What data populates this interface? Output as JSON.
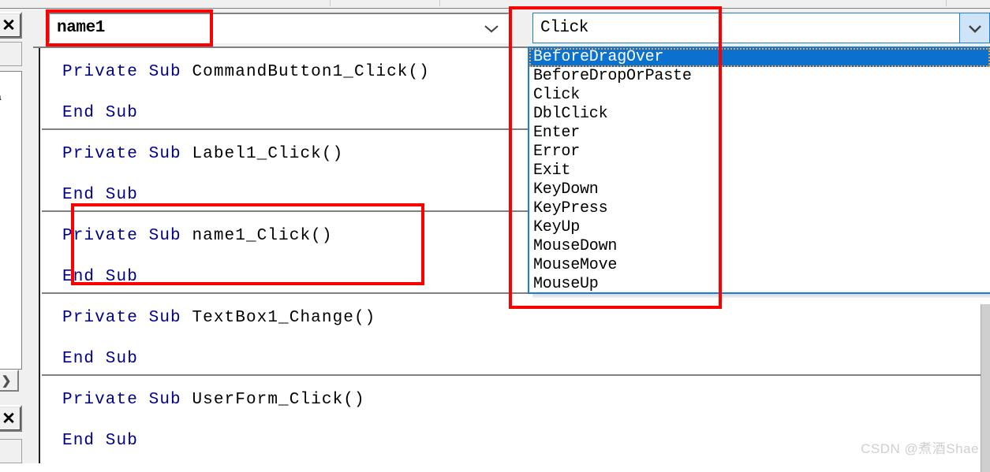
{
  "app": {
    "name": "VBA Editor Code Window",
    "watermark": "CSDN @煮酒Shae"
  },
  "toolbar": {
    "strip_label": ""
  },
  "left_panel": {
    "close_button_top_label": "✕",
    "blank_button_label": "",
    "scroll_right_arrow_label": "❯",
    "close_button_bottom_label": "✕",
    "text_fragment": "ila"
  },
  "object_combo": {
    "name": "object-dropdown",
    "value": "name1",
    "chevron": "chevron-down-icon"
  },
  "procedure_combo": {
    "name": "procedure-dropdown",
    "value": "Click",
    "chevron": "chevron-down-icon",
    "expanded": true,
    "options": [
      "BeforeDragOver",
      "BeforeDropOrPaste",
      "Click",
      "DblClick",
      "Enter",
      "Error",
      "Exit",
      "KeyDown",
      "KeyPress",
      "KeyUp",
      "MouseDown",
      "MouseMove",
      "MouseUp"
    ],
    "selected_index": 0,
    "selected_option": "BeforeDragOver"
  },
  "code": {
    "keyword_color": "#00008b",
    "text_color": "#000000",
    "procedures": [
      {
        "signature_keyword": "Private Sub ",
        "signature_name": "CommandButton1_Click()",
        "end_keyword": "End Sub",
        "highlighted": false
      },
      {
        "signature_keyword": "Private Sub ",
        "signature_name": "Label1_Click()",
        "end_keyword": "End Sub",
        "highlighted": false
      },
      {
        "signature_keyword": "Private Sub ",
        "signature_name": "name1_Click()",
        "end_keyword": "End Sub",
        "highlighted": true
      },
      {
        "signature_keyword": "Private Sub ",
        "signature_name": "TextBox1_Change()",
        "end_keyword": "End Sub",
        "highlighted": false
      },
      {
        "signature_keyword": "Private Sub ",
        "signature_name": "UserForm_Click()",
        "end_keyword": "End Sub",
        "highlighted": false
      }
    ]
  },
  "annotations": {
    "color": "#fb0000",
    "boxes": [
      {
        "label": "object-name-highlight"
      },
      {
        "label": "procedure-list-highlight"
      },
      {
        "label": "name1-click-procedure-highlight"
      }
    ]
  }
}
